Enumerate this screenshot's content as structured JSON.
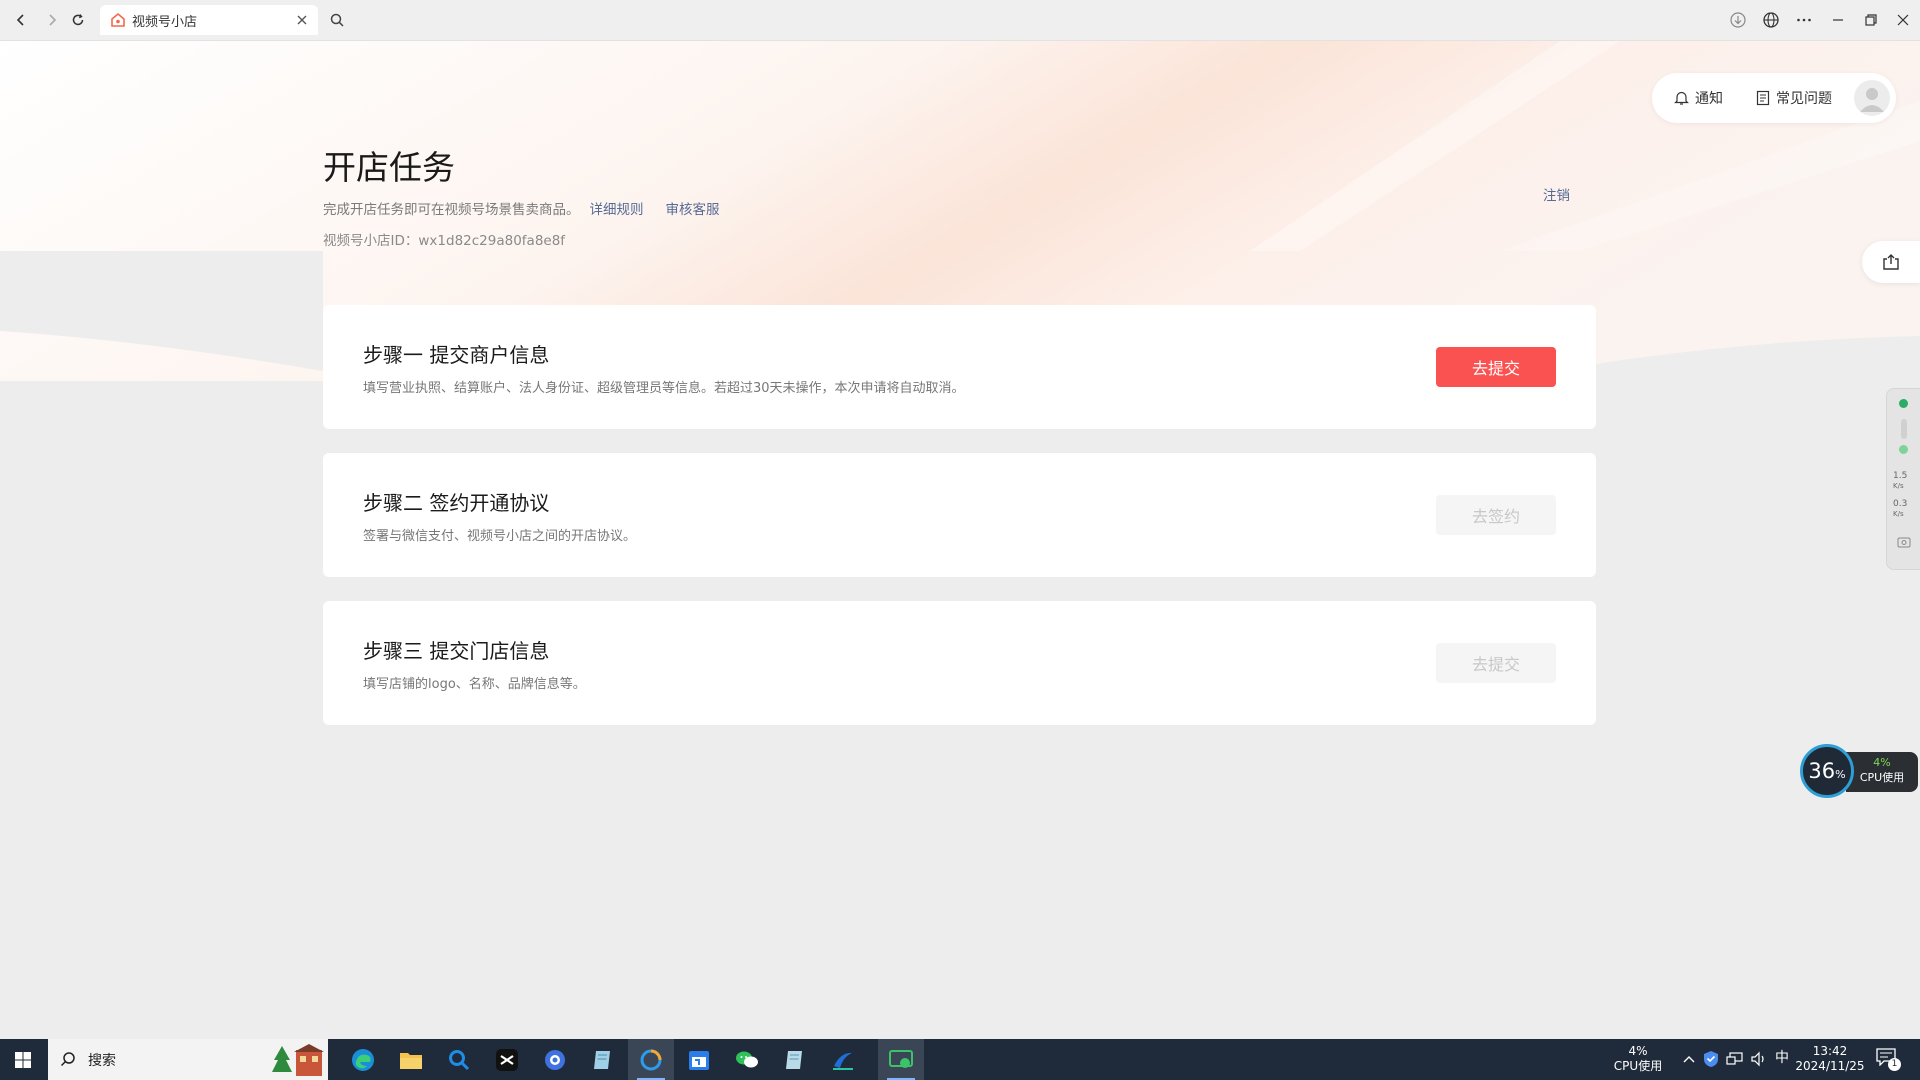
{
  "browser": {
    "tab_title": "视频号小店"
  },
  "userbar": {
    "notify": "通知",
    "faq": "常见问题"
  },
  "header": {
    "title": "开店任务",
    "subtitle": "完成开店任务即可在视频号场景售卖商品。",
    "rules_link": "详细规则",
    "service_link": "审核客服",
    "shop_id": "视频号小店ID：wx1d82c29a80fa8e8f",
    "logout": "注销"
  },
  "steps": [
    {
      "title": "步骤一 提交商户信息",
      "desc": "填写营业执照、结算账户、法人身份证、超级管理员等信息。若超过30天未操作，本次申请将自动取消。",
      "button": "去提交",
      "enabled": true
    },
    {
      "title": "步骤二 签约开通协议",
      "desc": "签署与微信支付、视频号小店之间的开店协议。",
      "button": "去签约",
      "enabled": false
    },
    {
      "title": "步骤三 提交门店信息",
      "desc": "填写店铺的logo、名称、品牌信息等。",
      "button": "去提交",
      "enabled": false
    }
  ],
  "widgets": {
    "net_up": "1.5",
    "net_up_unit": "K/s",
    "net_down": "0.3",
    "net_down_unit": "K/s",
    "cpu_circle": "36",
    "cpu_circle_unit": "%",
    "cpu_pct": "4%",
    "cpu_label": "CPU使用"
  },
  "taskbar": {
    "search_label": "搜索",
    "cpu_pct": "4%",
    "cpu_label": "CPU使用",
    "ime": "中",
    "time": "13:42",
    "date": "2024/11/25",
    "notification_count": "1"
  },
  "colors": {
    "primary": "#fa5151",
    "link": "#576b95"
  }
}
